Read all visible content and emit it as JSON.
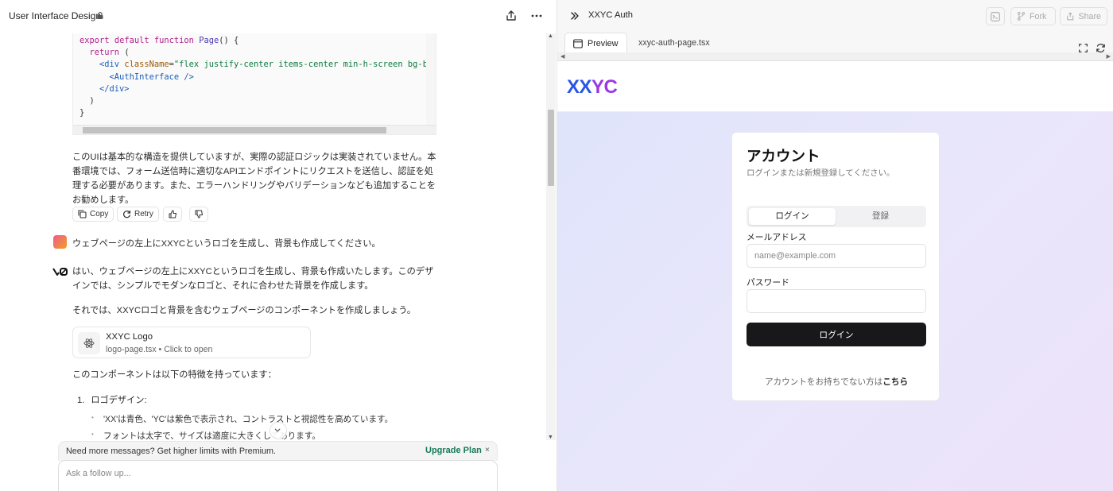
{
  "left_pane": {
    "title": "User Interface Design",
    "code_lines": {
      "l1_kw1": "export",
      "l1_kw2": "default",
      "l1_kw3": "function",
      "l1_fn": "Page",
      "l1_rest": "() {",
      "l2_kw": "return",
      "l2_rest": " (",
      "l3_tag": "<div",
      "l3_attr": "className",
      "l3_eq": "=",
      "l3_str": "\"flex justify-center items-center min-h-screen bg-backgr",
      "l4_tag": "<AuthInterface />",
      "l5_tag": "</div>",
      "l6": ")",
      "l7": "}"
    },
    "para1": "このUIは基本的な構造を提供していますが、実際の認証ロジックは実装されていません。本番環境では、フォーム送信時に適切なAPIエンドポイントにリクエストを送信し、認証を処理する必要があります。また、エラーハンドリングやバリデーションなども追加することをお勧めします。",
    "actions": {
      "copy": "Copy",
      "retry": "Retry"
    },
    "user_message": "ウェブページの左上にXXYCというロゴを生成し、背景も作成してください。",
    "para2": "はい、ウェブページの左上にXXYCというロゴを生成し、背景も作成いたします。このデザインでは、シンプルでモダンなロゴと、それに合わせた背景を作成します。",
    "para3": "それでは、XXYCロゴと背景を含むウェブページのコンポーネントを作成しましょう。",
    "file_card": {
      "name": "XXYC Logo",
      "sub": "logo-page.tsx • Click to open"
    },
    "para4": "このコンポーネントは以下の特徴を持っています：",
    "list": {
      "num": "1.",
      "item1": "ロゴデザイン:",
      "bullet1": "'XX'は青色、'YC'は紫色で表示され、コントラストと視認性を高めています。",
      "bullet2": "フォントは太字で、サイズは適度に大きくしてあります。"
    },
    "upgrade": {
      "text": "Need more messages? Get higher limits with Premium.",
      "link": "Upgrade Plan",
      "close": "×"
    },
    "follow_placeholder": "Ask a follow up..."
  },
  "right_pane": {
    "title": "XXYC Auth",
    "fork": "Fork",
    "share": "Share",
    "tab_preview": "Preview",
    "tab_file": "xxyc-auth-page.tsx"
  },
  "preview": {
    "logo_xx": "XX",
    "logo_yc": "YC",
    "card_title": "アカウント",
    "card_sub": "ログインまたは新規登録してください。",
    "tab_login": "ログイン",
    "tab_register": "登録",
    "email_label": "メールアドレス",
    "email_placeholder": "name@example.com",
    "password_label": "パスワード",
    "login_button": "ログイン",
    "signup_prefix": "アカウントをお持ちでない方は",
    "signup_link": "こちら"
  },
  "colors": {
    "logo_blue": "#2a55e6",
    "logo_purple": "#9b37e8",
    "upgrade_link": "#167a5a",
    "button_dark": "#18181b"
  },
  "icons": [
    "lock-icon",
    "share-icon",
    "more-icon",
    "copy-icon",
    "retry-icon",
    "thumbs-up-icon",
    "thumbs-down-icon",
    "react-icon",
    "chevron-down-icon",
    "collapse-icon",
    "terminal-icon",
    "fork-icon",
    "window-icon",
    "fullscreen-icon",
    "refresh-icon"
  ]
}
